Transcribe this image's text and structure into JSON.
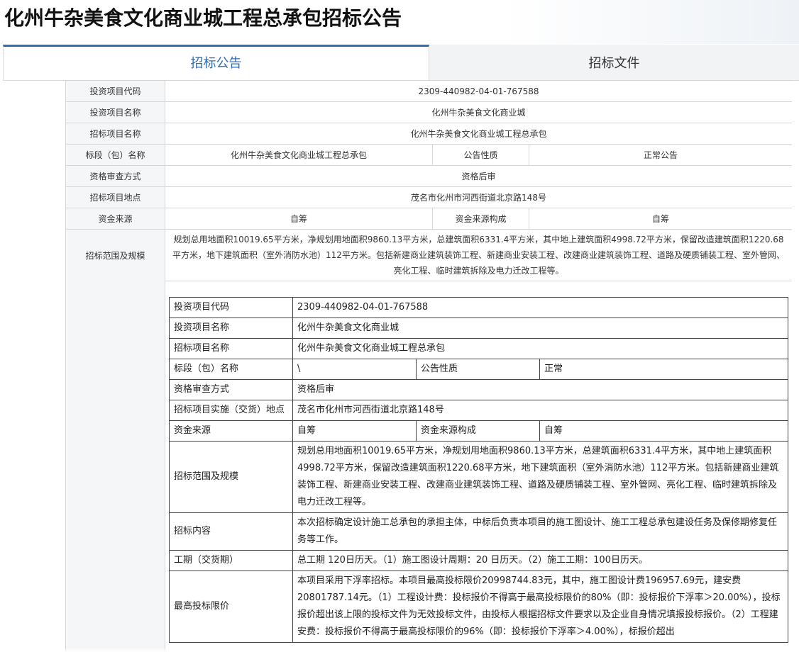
{
  "page": {
    "title": "化州牛杂美食文化商业城工程总承包招标公告"
  },
  "tabs": [
    {
      "label": "招标公告",
      "active": true
    },
    {
      "label": "招标文件",
      "active": false
    }
  ],
  "summary_table": {
    "project_code_label": "投资项目代码",
    "project_code": "2309-440982-04-01-767588",
    "project_name_label": "投资项目名称",
    "project_name": "化州牛杂美食文化商业城",
    "tender_name_label": "招标项目名称",
    "tender_name": "化州牛杂美食文化商业城工程总承包",
    "section_label": "标段（包）名称",
    "section_name": "化州牛杂美食文化商业城工程总承包",
    "notice_type_label": "公告性质",
    "notice_type": "正常公告",
    "qualification_label": "资格审查方式",
    "qualification": "资格后审",
    "location_label": "招标项目地点",
    "location": "茂名市化州市河西街道北京路148号",
    "fund_source_label": "资金来源",
    "fund_source": "自筹",
    "fund_composition_label": "资金来源构成",
    "fund_composition": "自筹",
    "scope_label": "招标范围及规模",
    "scope": "规划总用地面积10019.65平方米，净规划用地面积9860.13平方米，总建筑面积6331.4平方米，其中地上建筑面积4998.72平方米，保留改造建筑面积1220.68平方米，地下建筑面积（室外消防水池）112平方米。包括新建商业建筑装饰工程、新建商业安装工程、改建商业建筑装饰工程、道路及硬质铺装工程、室外管网、亮化工程、临时建筑拆除及电力迁改工程等。"
  },
  "detail_table": {
    "project_code_label": "投资项目代码",
    "project_code": "2309-440982-04-01-767588",
    "project_name_label": "投资项目名称",
    "project_name": "化州牛杂美食文化商业城",
    "tender_name_label": "招标项目名称",
    "tender_name": "化州牛杂美食文化商业城工程总承包",
    "section_label": "标段（包）名称",
    "section_name": "\\",
    "notice_type_label": "公告性质",
    "notice_type": "正常",
    "qualification_label": "资格审查方式",
    "qualification": "资格后审",
    "location_label": "招标项目实施（交货）地点",
    "location": "茂名市化州市河西街道北京路148号",
    "fund_source_label": "资金来源",
    "fund_source": "自筹",
    "fund_composition_label": "资金来源构成",
    "fund_composition": "自筹",
    "scope_label": "招标范围及规模",
    "scope": "规划总用地面积10019.65平方米，净规划用地面积9860.13平方米，总建筑面积6331.4平方米，其中地上建筑面积4998.72平方米，保留改造建筑面积1220.68平方米，地下建筑面积（室外消防水池）112平方米。包括新建商业建筑装饰工程、新建商业安装工程、改建商业建筑装饰工程、道路及硬质铺装工程、室外管网、亮化工程、临时建筑拆除及电力迁改工程等。",
    "content_label": "招标内容",
    "content": "本次招标确定设计施工总承包的承担主体，中标后负责本项目的施工图设计、施工工程总承包建设任务及保修期修复任务等工作。",
    "period_label": "工期（交货期）",
    "period": "总工期 120日历天。（1）施工图设计周期：20 日历天。（2）施工工期：100日历天。",
    "max_price_label": "最高投标限价",
    "max_price": "本项目采用下浮率招标。本项目最高投标限价20998744.83元，其中，施工图设计费196957.69元，建安费20801787.14元。（1）工程设计费：投标报价不得高于最高投标限价的80%（即：投标报价下浮率＞20.00%），投标报价超出该上限的投标文件为无效投标文件，由投标人根据招标文件要求以及企业自身情况填报投标报价。（2）工程建安费：投标报价不得高于最高投标限价的96%（即：投标报价下浮率＞4.00%），标报价超出"
  }
}
